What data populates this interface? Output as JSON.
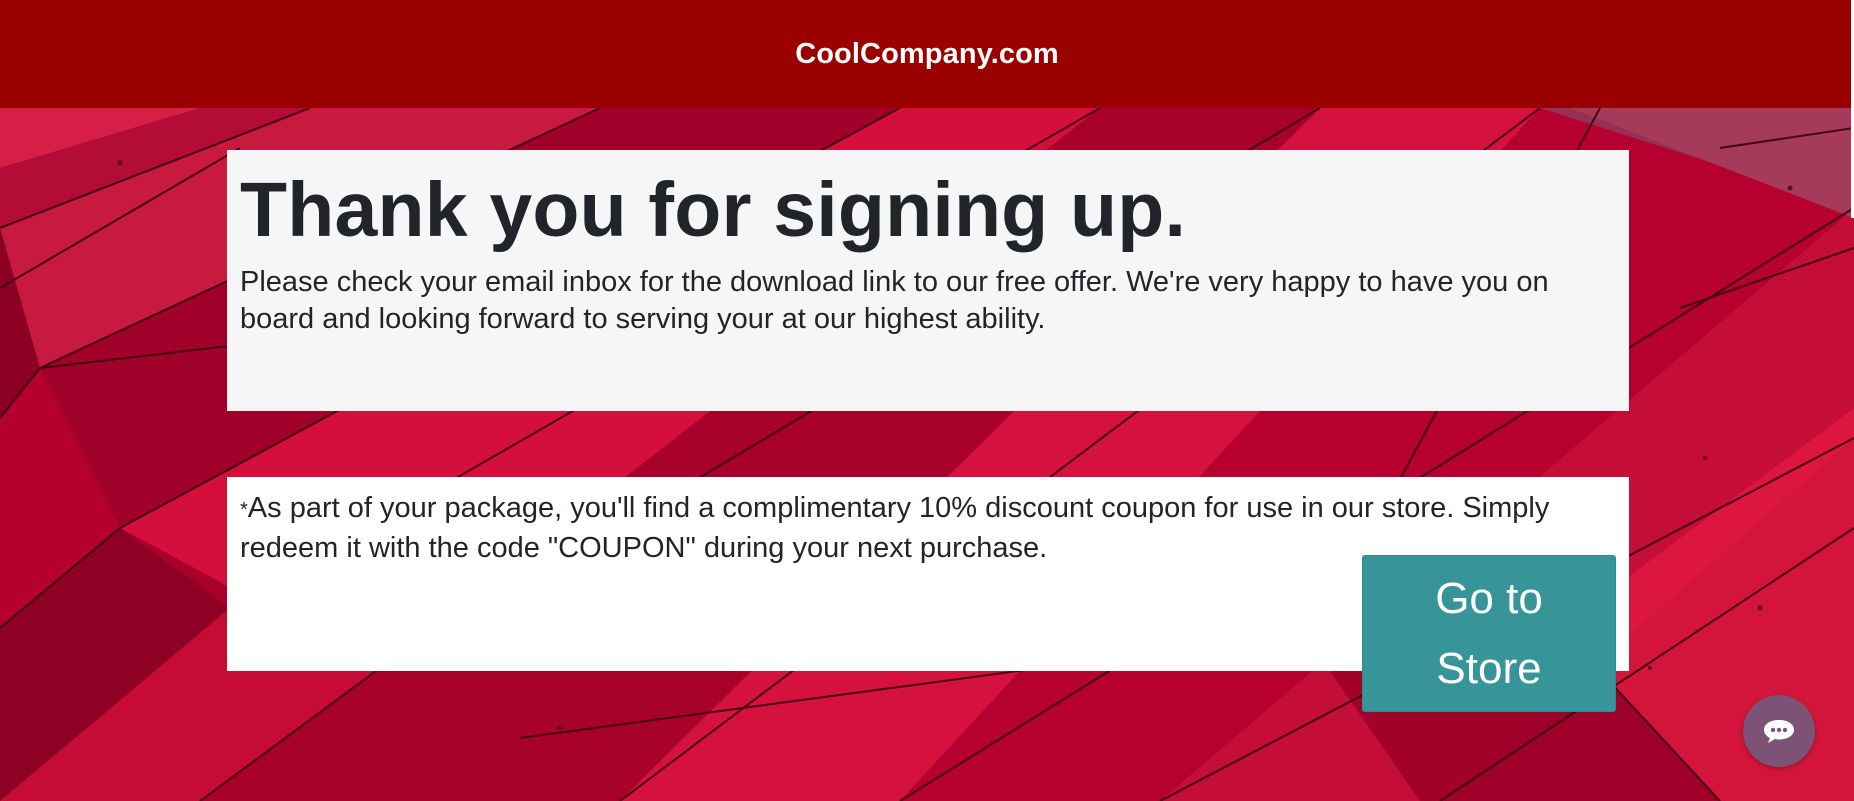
{
  "header": {
    "brand": "CoolCompany.com"
  },
  "main_card": {
    "title": "Thank you for signing up.",
    "message": "Please check your email inbox for the download link to our free offer. We're very happy to have you on board and looking forward to serving your at our highest ability."
  },
  "coupon_card": {
    "marker": "*",
    "text": "As part of your package, you'll find a complimentary 10% discount coupon for use in our store. Simply redeem it with the code \"COUPON\" during your next purchase."
  },
  "store_button": {
    "label": "Go to Store"
  },
  "chat_button": {
    "icon": "chat-bubble-icon"
  },
  "colors": {
    "header": "#9b0000",
    "background": "#b0002a",
    "button": "#379599",
    "chat": "#7c5374",
    "text": "#212529"
  }
}
